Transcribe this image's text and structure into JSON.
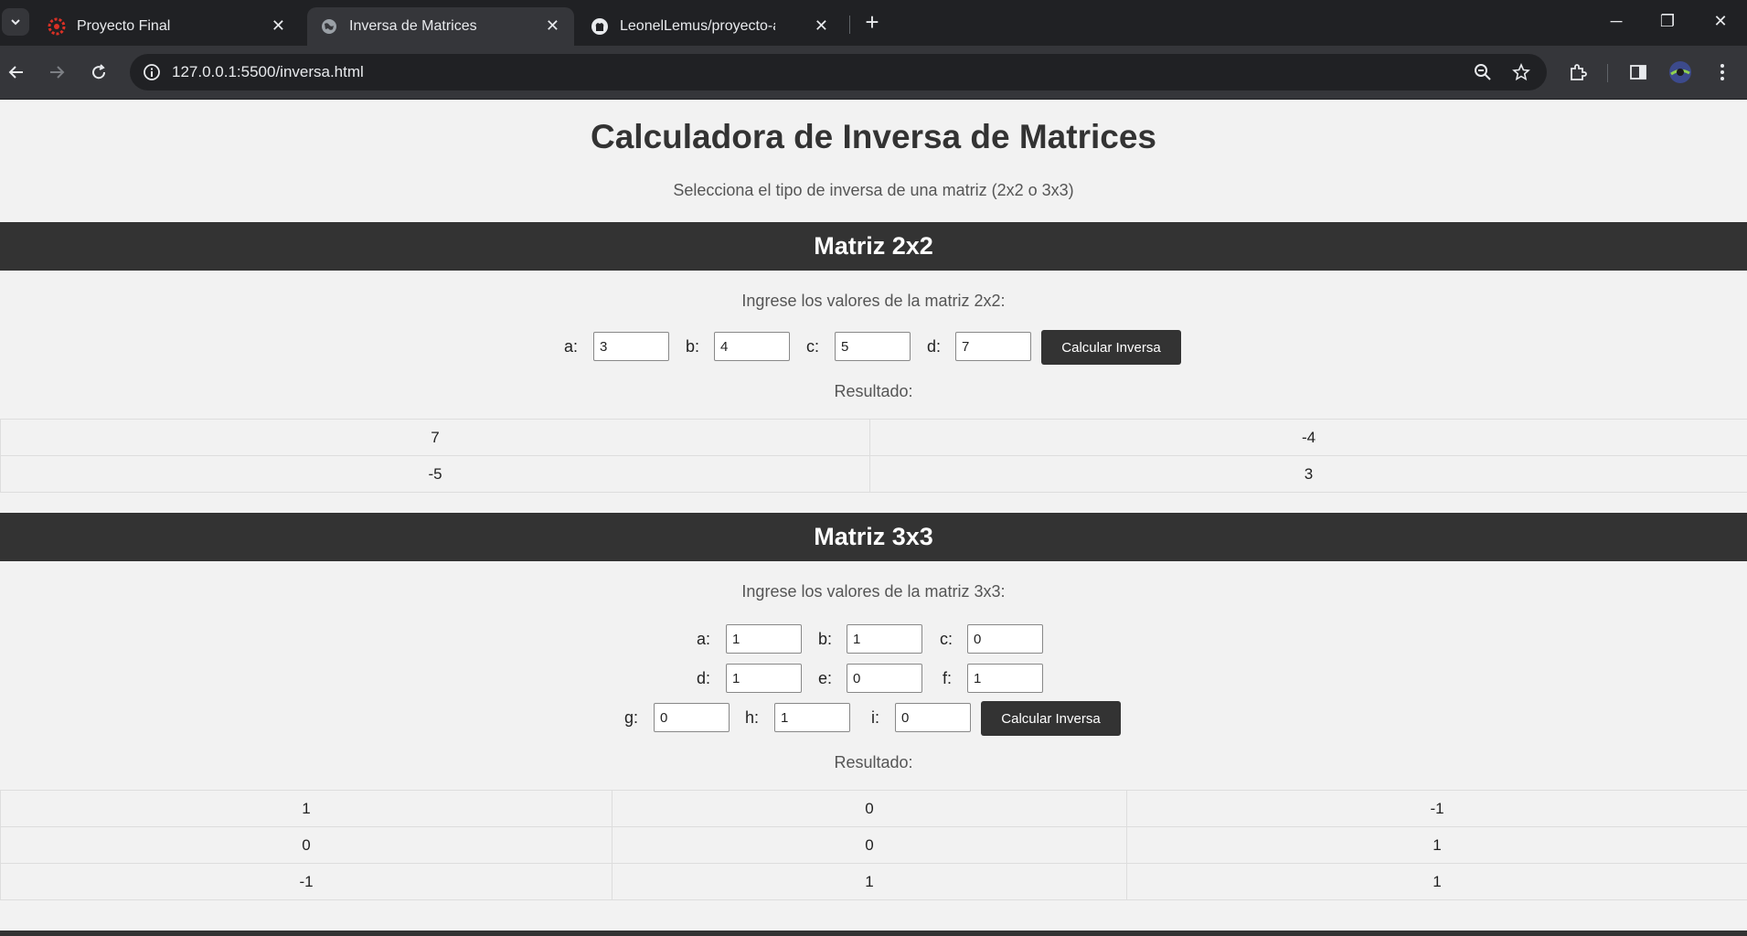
{
  "browser": {
    "tabs": [
      {
        "title": "Proyecto Final",
        "icon": "gear-favicon",
        "active": false
      },
      {
        "title": "Inversa de Matrices",
        "icon": "globe-favicon",
        "active": true
      },
      {
        "title": "LeonelLemus/proyecto-algebra",
        "icon": "github-favicon",
        "active": false
      }
    ],
    "url": "127.0.0.1:5500/inversa.html"
  },
  "page": {
    "title": "Calculadora de Inversa de Matrices",
    "subtitle": "Selecciona el tipo de inversa de una matriz (2x2 o 3x3)"
  },
  "matrix2": {
    "header": "Matriz 2x2",
    "prompt": "Ingrese los valores de la matriz 2x2:",
    "labels": [
      "a:",
      "b:",
      "c:",
      "d:"
    ],
    "values": [
      "3",
      "4",
      "5",
      "7"
    ],
    "button": "Calcular Inversa",
    "result_label": "Resultado:",
    "result": [
      [
        "7",
        "-4"
      ],
      [
        "-5",
        "3"
      ]
    ]
  },
  "matrix3": {
    "header": "Matriz 3x3",
    "prompt": "Ingrese los valores de la matriz 3x3:",
    "labels": [
      "a:",
      "b:",
      "c:",
      "d:",
      "e:",
      "f:",
      "g:",
      "h:",
      "i:"
    ],
    "values": [
      "1",
      "1",
      "0",
      "1",
      "0",
      "1",
      "0",
      "1",
      "0"
    ],
    "button": "Calcular Inversa",
    "result_label": "Resultado:",
    "result": [
      [
        "1",
        "0",
        "-1"
      ],
      [
        "0",
        "0",
        "1"
      ],
      [
        "-1",
        "1",
        "1"
      ]
    ]
  }
}
